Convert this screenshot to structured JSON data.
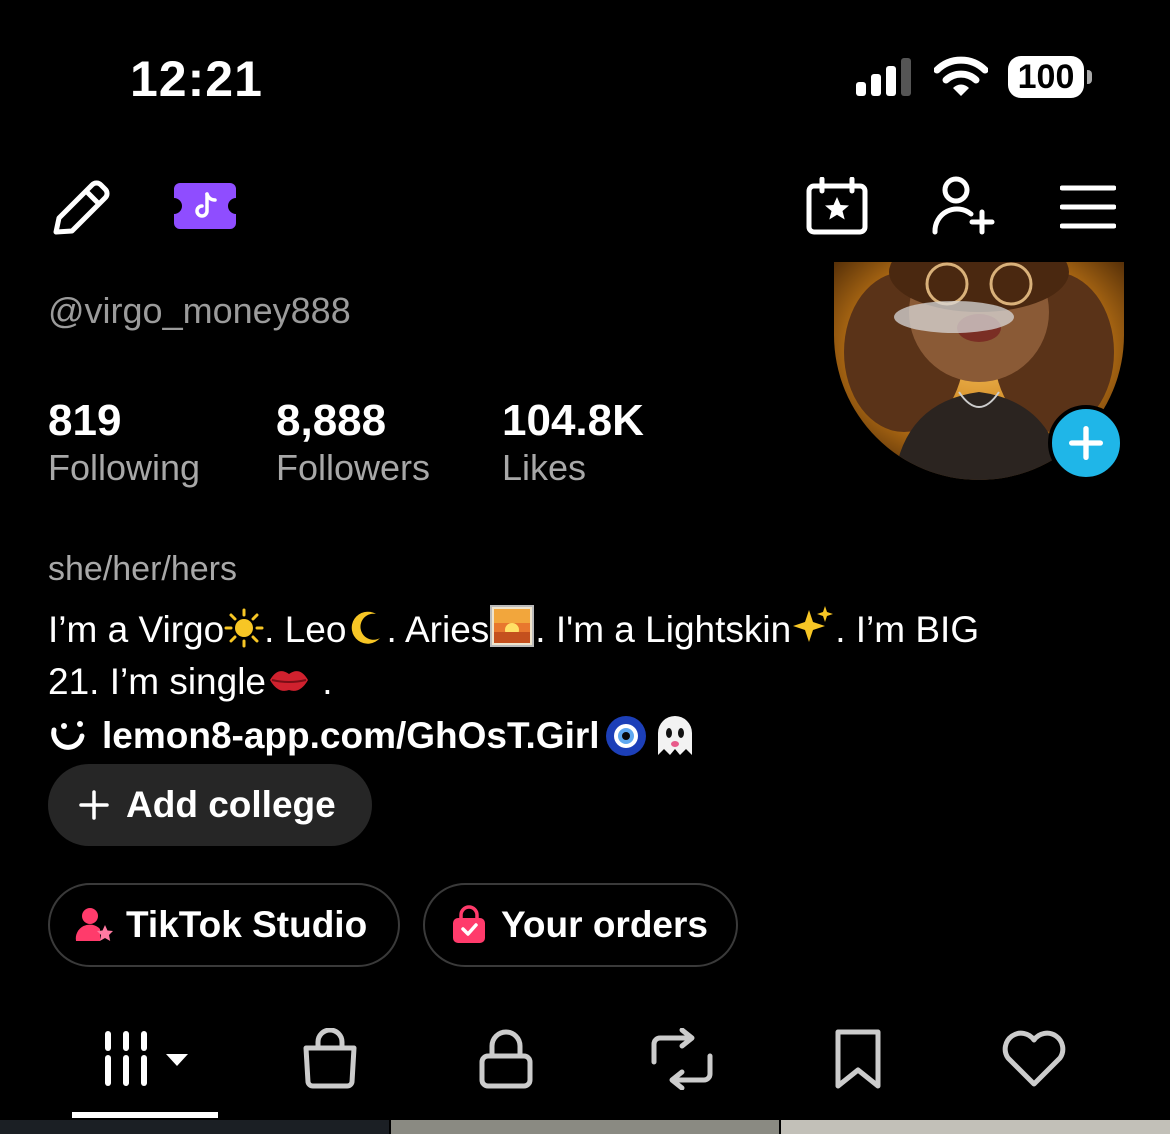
{
  "status_bar": {
    "time": "12:21",
    "battery": "100"
  },
  "profile": {
    "username": "@virgo_money888",
    "stats": [
      {
        "value": "819",
        "label": "Following"
      },
      {
        "value": "8,888",
        "label": "Followers"
      },
      {
        "value": "104.8K",
        "label": "Likes"
      }
    ],
    "pronouns": "she/her/hers",
    "bio": {
      "line1_a": "I’m a Virgo",
      "line1_b": ". Leo",
      "line1_c": ". Aries",
      "line1_d": ". I'm a Lightskin",
      "line1_e": ". I’m BIG",
      "line2_a": "21. I’m single",
      "line2_b": " ."
    },
    "link": "lemon8-app.com/GhOsT.Girl",
    "add_college_label": "Add college"
  },
  "shortcuts": {
    "studio_label": "TikTok Studio",
    "orders_label": "Your orders"
  },
  "icons": {
    "top_left": [
      "pencil-icon",
      "tiktok-ticket-icon"
    ],
    "top_right": [
      "calendar-star-icon",
      "add-friend-icon",
      "menu-icon"
    ],
    "tabs": [
      "videos-grid-icon",
      "shop-bag-icon",
      "lock-icon",
      "repost-icon",
      "bookmark-icon",
      "heart-icon"
    ]
  },
  "colors": {
    "background": "#000000",
    "accent_plus": "#1fb6e8",
    "ticket_purple": "#8f4dff",
    "muted_text": "#a8a8a8"
  }
}
